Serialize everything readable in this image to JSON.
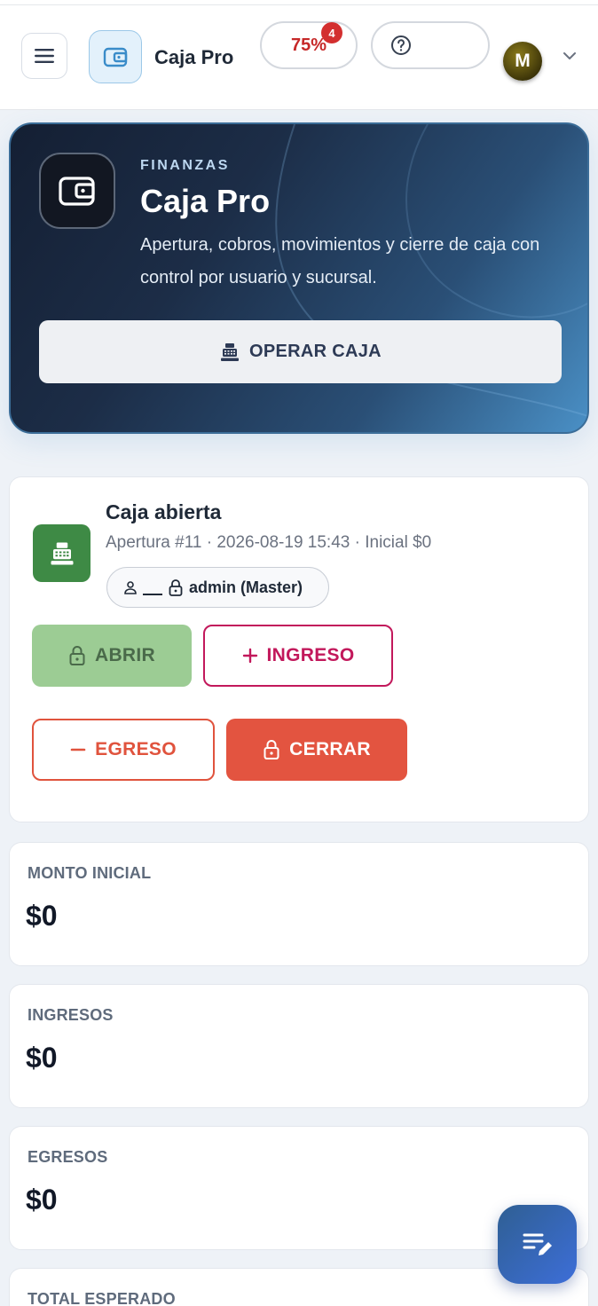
{
  "header": {
    "app_name": "Caja Pro",
    "progress_label": "75%",
    "notification_count": "4",
    "help_label": "",
    "avatar_initial": "M"
  },
  "hero": {
    "kicker": "FINANZAS",
    "title": "Caja Pro",
    "description": "Apertura, cobros, movimientos y cierre de caja con control por usuario y sucursal.",
    "primary_button": "OPERAR CAJA"
  },
  "status": {
    "title": "Caja abierta",
    "subtitle": "Apertura #11 · 2026-08-19 15:43 · Inicial $0",
    "user_chip": "admin (Master)",
    "buttons": {
      "open": "ABRIR",
      "income": "INGRESO",
      "expense": "EGRESO",
      "close": "CERRAR"
    }
  },
  "stats": [
    {
      "label": "MONTO INICIAL",
      "value": "$0"
    },
    {
      "label": "INGRESOS",
      "value": "$0"
    },
    {
      "label": "EGRESOS",
      "value": "$0"
    },
    {
      "label": "TOTAL ESPERADO",
      "value": ""
    }
  ],
  "colors": {
    "open_button_bg": "#9ccc94",
    "income_accent": "#c2185b",
    "expense_accent": "#e0533d",
    "close_button_bg": "#e35440",
    "register_icon_bg": "#3e8a45"
  }
}
